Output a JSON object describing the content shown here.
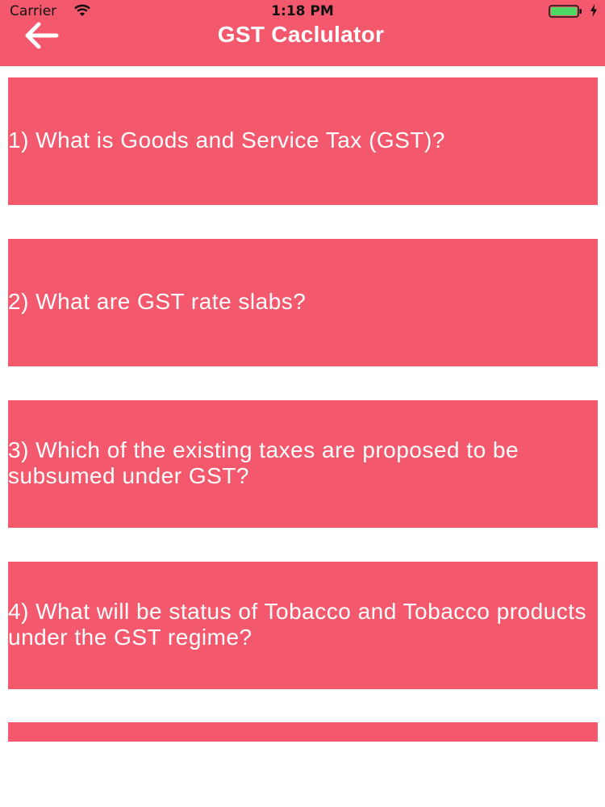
{
  "status_bar": {
    "carrier": "Carrier",
    "time": "1:18 PM",
    "battery_color": "#4cd964"
  },
  "nav": {
    "title": "GST Caclulator",
    "back_icon": "arrow-left-icon",
    "background": "#f4586c"
  },
  "questions": [
    {
      "label": "1) What is Goods and Service Tax (GST)?"
    },
    {
      "label": "2) What are GST rate slabs?"
    },
    {
      "label": "3) Which of the existing taxes are proposed to be subsumed under GST?"
    },
    {
      "label": "4) What will be status of Tobacco and Tobacco products under the GST regime?"
    },
    {
      "label": ""
    }
  ],
  "colors": {
    "accent": "#f4586c",
    "text_on_accent": "#ffffff",
    "background": "#ffffff"
  }
}
